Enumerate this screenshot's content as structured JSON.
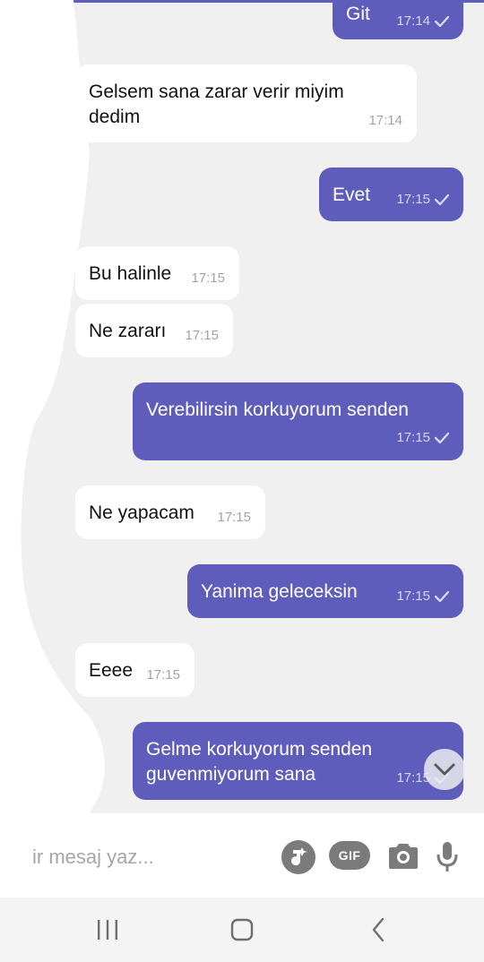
{
  "messages": [
    {
      "dir": "out",
      "text": "Git",
      "time": "17:14",
      "read": true
    },
    {
      "dir": "in",
      "text": "Gelsem sana zarar verir miyim\n dedim",
      "time": "17:14"
    },
    {
      "dir": "out",
      "text": "Evet",
      "time": "17:15",
      "read": true
    },
    {
      "dir": "in",
      "text": "Bu halinle",
      "time": "17:15"
    },
    {
      "dir": "in",
      "text": "Ne zararı",
      "time": "17:15"
    },
    {
      "dir": "out",
      "text": "Verebilirsin korkuyorum senden",
      "time": "17:15",
      "read": true
    },
    {
      "dir": "in",
      "text": "Ne yapacam",
      "time": "17:15"
    },
    {
      "dir": "out",
      "text": "Yanima geleceksin",
      "time": "17:15",
      "read": true
    },
    {
      "dir": "in",
      "text": "Eeee",
      "time": "17:15"
    },
    {
      "dir": "out",
      "text": "Gelme korkuyorum senden\nguvenmiyorum sana",
      "time": "17:15",
      "read": true
    }
  ],
  "composer": {
    "placeholder": "ir mesaj yaz...",
    "gif_label": "GIF",
    "icons": [
      "sticker-icon",
      "gif-icon",
      "camera-icon",
      "microphone-icon"
    ]
  },
  "nav": {
    "icons": [
      "recent-apps-icon",
      "home-icon",
      "back-icon"
    ]
  },
  "colors": {
    "accent": "#5f5dbb",
    "incoming_bubble": "#ffffff",
    "background": "#f0f0f0"
  }
}
